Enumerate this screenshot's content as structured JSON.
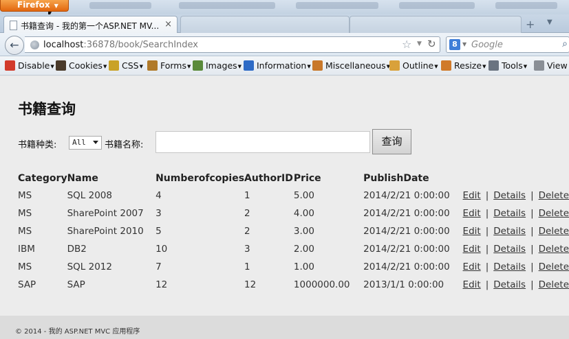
{
  "window": {
    "app_menu_label": "Firefox"
  },
  "tab": {
    "title": "书籍查询 - 我的第一个ASP.NET MV...",
    "close_glyph": "×"
  },
  "nav": {
    "url_host": "localhost",
    "url_rest": ":36878/book/SearchIndex",
    "search_engine_glyph": "8",
    "search_placeholder": "Google"
  },
  "toolbar": {
    "items": [
      {
        "label": "Disable",
        "icon": "disable-icon",
        "color": "#d23b2b"
      },
      {
        "label": "Cookies",
        "icon": "cookies-icon",
        "color": "#4a3a2a"
      },
      {
        "label": "CSS",
        "icon": "css-icon",
        "color": "#c9a227"
      },
      {
        "label": "Forms",
        "icon": "forms-icon",
        "color": "#b07a2a"
      },
      {
        "label": "Images",
        "icon": "images-icon",
        "color": "#5a8a3a"
      },
      {
        "label": "Information",
        "icon": "information-icon",
        "color": "#2e6bc6"
      },
      {
        "label": "Miscellaneous",
        "icon": "miscellaneous-icon",
        "color": "#c8782a"
      },
      {
        "label": "Outline",
        "icon": "outline-icon",
        "color": "#d9a13a"
      },
      {
        "label": "Resize",
        "icon": "resize-icon",
        "color": "#d07a2a"
      },
      {
        "label": "Tools",
        "icon": "tools-icon",
        "color": "#6a7380"
      },
      {
        "label": "View S",
        "icon": "view-source-icon",
        "color": "#8a8f96"
      }
    ]
  },
  "page": {
    "heading": "书籍查询",
    "search": {
      "category_label": "书籍种类:",
      "category_value": "All",
      "name_label": "书籍名称:",
      "name_value": "",
      "submit_label": "查询"
    },
    "table": {
      "headers": [
        "Category",
        "Name",
        "Numberofcopies",
        "AuthorID",
        "Price",
        "PublishDate"
      ],
      "rows": [
        {
          "category": "MS",
          "name": "SQL 2008",
          "copies": "4",
          "author": "1",
          "price": "5.00",
          "date": "2014/2/21 0:00:00"
        },
        {
          "category": "MS",
          "name": "SharePoint 2007",
          "copies": "3",
          "author": "2",
          "price": "4.00",
          "date": "2014/2/21 0:00:00"
        },
        {
          "category": "MS",
          "name": "SharePoint 2010",
          "copies": "5",
          "author": "2",
          "price": "3.00",
          "date": "2014/2/21 0:00:00"
        },
        {
          "category": "IBM",
          "name": "DB2",
          "copies": "10",
          "author": "3",
          "price": "2.00",
          "date": "2014/2/21 0:00:00"
        },
        {
          "category": "MS",
          "name": "SQL 2012",
          "copies": "7",
          "author": "1",
          "price": "1.00",
          "date": "2014/2/21 0:00:00"
        },
        {
          "category": "SAP",
          "name": "SAP",
          "copies": "12",
          "author": "12",
          "price": "1000000.00",
          "date": "2013/1/1 0:00:00"
        }
      ],
      "action_edit": "Edit",
      "action_details": "Details",
      "action_delete": "Delete",
      "separator": "|"
    }
  },
  "footer": {
    "text": "© 2014 - 我的 ASP.NET MVC 应用程序"
  }
}
